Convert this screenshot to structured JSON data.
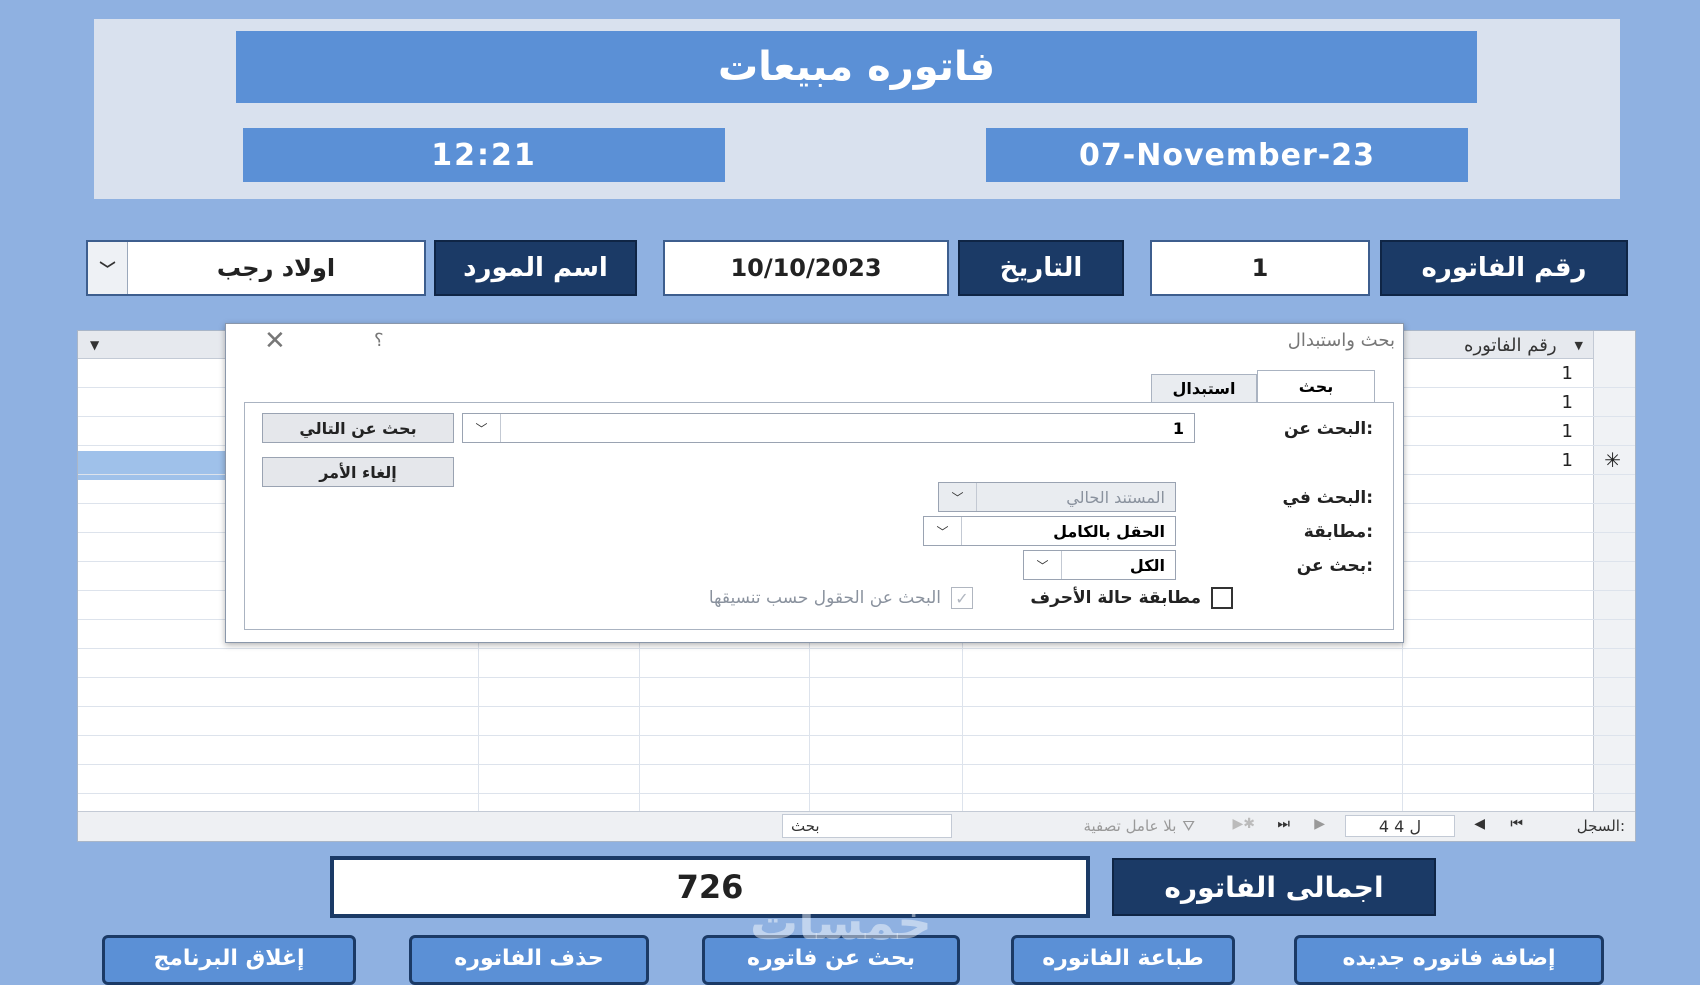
{
  "header": {
    "title": "فاتوره مبيعات",
    "time": "12:21",
    "date": "07-November-23"
  },
  "form": {
    "invoice_number_label": "رقم الفاتوره",
    "invoice_number_value": "1",
    "date_label": "التاريخ",
    "date_value": "10/10/2023",
    "supplier_label": "اسم المورد",
    "supplier_value": "اولاد رجب"
  },
  "datasheet": {
    "column_header": "رقم الفاتوره",
    "rows": [
      "1",
      "1",
      "1",
      "1"
    ],
    "new_record_marker": "✳"
  },
  "navigation": {
    "record_label": "السجل:",
    "position": "4 ل 4",
    "filter_label": "بلا عامل تصفية",
    "search_label": "بحث"
  },
  "dialog": {
    "title": "بحث واستبدال",
    "help": "؟",
    "close": "✕",
    "tabs": [
      "بحث",
      "استبدال"
    ],
    "find_what_label": "البحث عن:",
    "find_what_value": "1",
    "look_in_label": "البحث في:",
    "look_in_value": "المستند الحالي",
    "match_label": "مطابقة:",
    "match_value": "الحقل بالكامل",
    "search_label": "بحث عن:",
    "search_value": "الكل",
    "match_case_label": "مطابقة حالة الأحرف",
    "search_formatted_label": "البحث عن الحقول حسب تنسيقها",
    "find_next_label": "بحث عن التالي",
    "cancel_label": "إلغاء الأمر"
  },
  "total": {
    "label": "اجمالى الفاتوره",
    "value": "726"
  },
  "buttons": {
    "new_invoice": "إضافة فاتوره جديده",
    "print_invoice": "طباعة الفاتوره",
    "search_invoice": "بحث عن فاتوره",
    "delete_invoice": "حذف الفاتوره",
    "close_program": "إغلاق البرنامج"
  },
  "watermark": "خمسات"
}
